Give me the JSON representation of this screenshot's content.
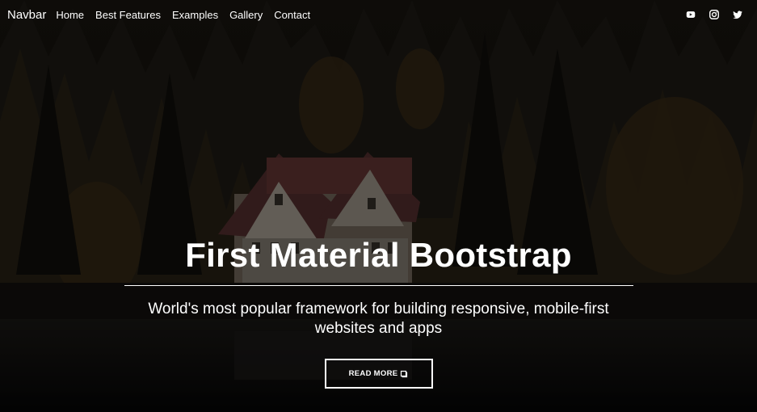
{
  "navbar": {
    "brand": "Navbar",
    "links": [
      "Home",
      "Best Features",
      "Examples",
      "Gallery",
      "Contact"
    ],
    "social": [
      {
        "icon": "youtube-icon"
      },
      {
        "icon": "instagram-icon"
      },
      {
        "icon": "twitter-icon"
      }
    ]
  },
  "hero": {
    "title": "First Material Bootstrap",
    "subtitle": "World's most popular framework for building responsive, mobile-first websites and apps",
    "button_label": "READ MORE",
    "button_icon": "book-icon",
    "background": "dark forest with house by lake"
  }
}
